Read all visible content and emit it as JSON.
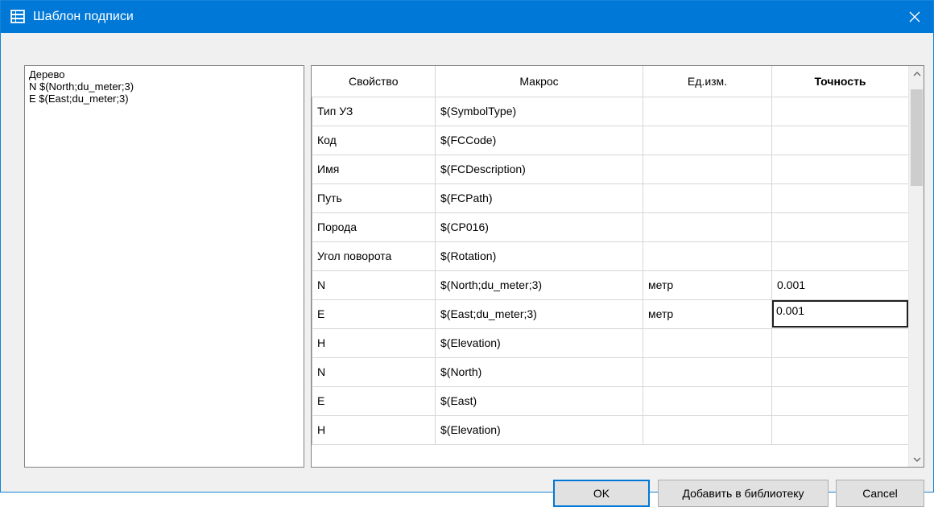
{
  "window": {
    "title": "Шаблон подписи"
  },
  "tree": {
    "lines": [
      "Дерево",
      "N $(North;du_meter;3)",
      "E $(East;du_meter;3)"
    ]
  },
  "grid": {
    "headers": [
      "Свойство",
      "Макрос",
      "Ед.изм.",
      "Точность"
    ],
    "rows": [
      {
        "property": "Тип УЗ",
        "macro": "$(SymbolType)",
        "unit": "",
        "precision": ""
      },
      {
        "property": "Код",
        "macro": "$(FCCode)",
        "unit": "",
        "precision": ""
      },
      {
        "property": "Имя",
        "macro": "$(FCDescription)",
        "unit": "",
        "precision": ""
      },
      {
        "property": "Путь",
        "macro": "$(FCPath)",
        "unit": "",
        "precision": ""
      },
      {
        "property": "Порода",
        "macro": "$(CP016)",
        "unit": "",
        "precision": ""
      },
      {
        "property": "Угол поворота",
        "macro": "$(Rotation)",
        "unit": "",
        "precision": ""
      },
      {
        "property": "N",
        "macro": "$(North;du_meter;3)",
        "unit": "метр",
        "precision": "0.001"
      },
      {
        "property": "E",
        "macro": "$(East;du_meter;3)",
        "unit": "метр",
        "precision": "0.001"
      },
      {
        "property": "H",
        "macro": "$(Elevation)",
        "unit": "",
        "precision": ""
      },
      {
        "property": "N",
        "macro": "$(North)",
        "unit": "",
        "precision": ""
      },
      {
        "property": "E",
        "macro": "$(East)",
        "unit": "",
        "precision": ""
      },
      {
        "property": "H",
        "macro": "$(Elevation)",
        "unit": "",
        "precision": ""
      }
    ]
  },
  "buttons": {
    "ok": "OK",
    "add_to_library": "Добавить в библиотеку",
    "cancel": "Cancel"
  },
  "colors": {
    "titlebar": "#0078d7",
    "grid_line": "#d6d6d6",
    "button_face": "#e1e1e1",
    "default_button_border": "#0078d7"
  }
}
